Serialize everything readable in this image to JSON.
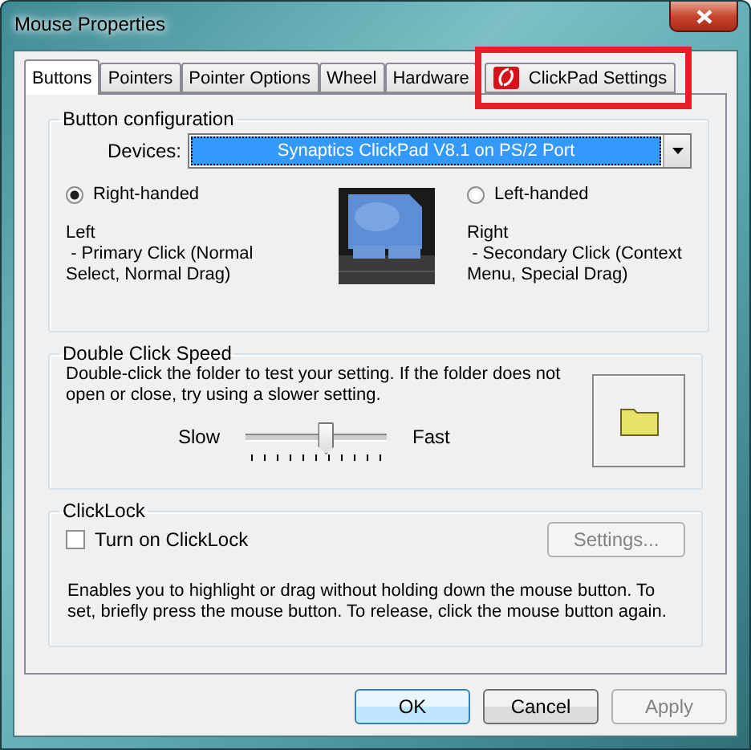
{
  "window": {
    "title": "Mouse Properties"
  },
  "tabs": [
    {
      "label": "Buttons",
      "selected": true,
      "highlighted": false,
      "kind": "plain"
    },
    {
      "label": "Pointers",
      "selected": false,
      "highlighted": false,
      "kind": "plain"
    },
    {
      "label": "Pointer Options",
      "selected": false,
      "highlighted": false,
      "kind": "plain"
    },
    {
      "label": "Wheel",
      "selected": false,
      "highlighted": false,
      "kind": "plain"
    },
    {
      "label": "Hardware",
      "selected": false,
      "highlighted": false,
      "kind": "plain"
    },
    {
      "label": "ClickPad Settings",
      "selected": false,
      "highlighted": true,
      "kind": "icon"
    }
  ],
  "button_configuration": {
    "title": "Button configuration",
    "device_label": "Devices:",
    "device": "Synaptics ClickPad V8.1 on PS/2 Port",
    "options": [
      {
        "label": "Right-handed",
        "selected": true,
        "button": "Left",
        "description": " - Primary Click (Normal Select, Normal Drag)"
      },
      {
        "label": "Left-handed",
        "selected": false,
        "button": "Right",
        "description": " - Secondary Click (Context Menu, Special Drag)"
      }
    ]
  },
  "double_click_speed": {
    "title": "Double Click Speed",
    "description": "Double-click the folder to test your setting.  If the folder does not open or close, try using a slower setting.",
    "slow_label": "Slow",
    "fast_label": "Fast",
    "level": 0.56
  },
  "clicklock": {
    "title": "ClickLock",
    "checkbox": {
      "label": "Turn on ClickLock",
      "checked": false
    },
    "settings_button": {
      "label": "Settings...",
      "disabled": true
    },
    "description": "Enables you to highlight or drag without holding down the mouse button.  To set, briefly press the mouse button.  To release, click the mouse button again."
  },
  "buttons": [
    {
      "label": "OK",
      "default": true,
      "disabled": false
    },
    {
      "label": "Cancel",
      "default": false,
      "disabled": false
    },
    {
      "label": "Apply",
      "default": false,
      "disabled": true
    }
  ]
}
